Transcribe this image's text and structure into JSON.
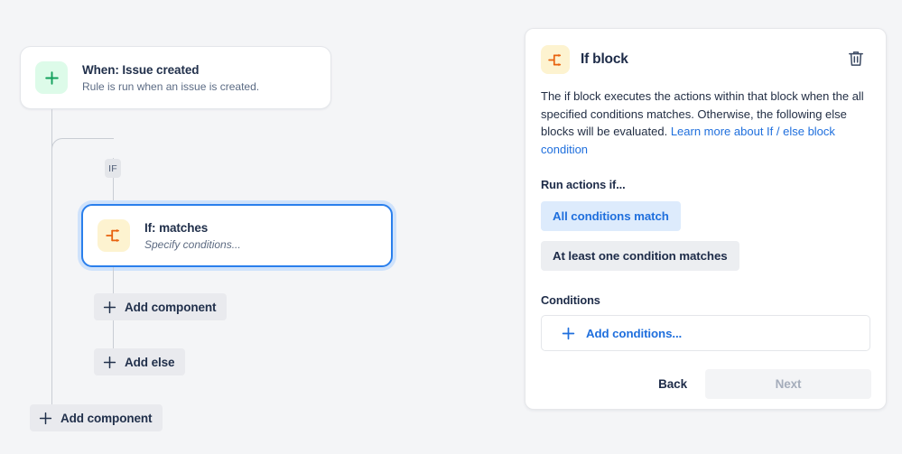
{
  "canvas": {
    "trigger": {
      "icon": "plus-icon",
      "title": "When: Issue created",
      "subtitle": "Rule is run when an issue is created."
    },
    "branch_badge": "IF",
    "if_node": {
      "icon": "if-branch-icon",
      "title": "If: matches",
      "subtitle": "Specify conditions..."
    },
    "buttons": {
      "add_component_branch": "Add component",
      "add_else": "Add else",
      "add_component_root": "Add component"
    }
  },
  "panel": {
    "icon": "if-branch-icon",
    "title": "If block",
    "delete_icon": "trash-icon",
    "description": {
      "text": "The if block executes the actions within that block when the all specified conditions matches. Otherwise, the following else blocks will be evaluated. ",
      "link": "Learn more about If / else block condition"
    },
    "run_actions_label": "Run actions if...",
    "options": [
      {
        "label": "All conditions match",
        "selected": true
      },
      {
        "label": "At least one condition matches",
        "selected": false
      }
    ],
    "conditions_label": "Conditions",
    "add_conditions_label": "Add conditions...",
    "footer": {
      "back_label": "Back",
      "next_label": "Next",
      "next_disabled": true
    }
  },
  "colors": {
    "canvas_bg": "#f4f5f7",
    "accent_blue": "#1f6fdd",
    "selected_border": "#2a7fec",
    "if_icon_orange": "#e8620e",
    "if_icon_bg": "#fdf3d0",
    "trigger_icon_green": "#12a05c",
    "trigger_icon_bg": "#ddfbe9",
    "text_dark": "#1d2b48",
    "connector_gray": "#c9cdd4"
  }
}
